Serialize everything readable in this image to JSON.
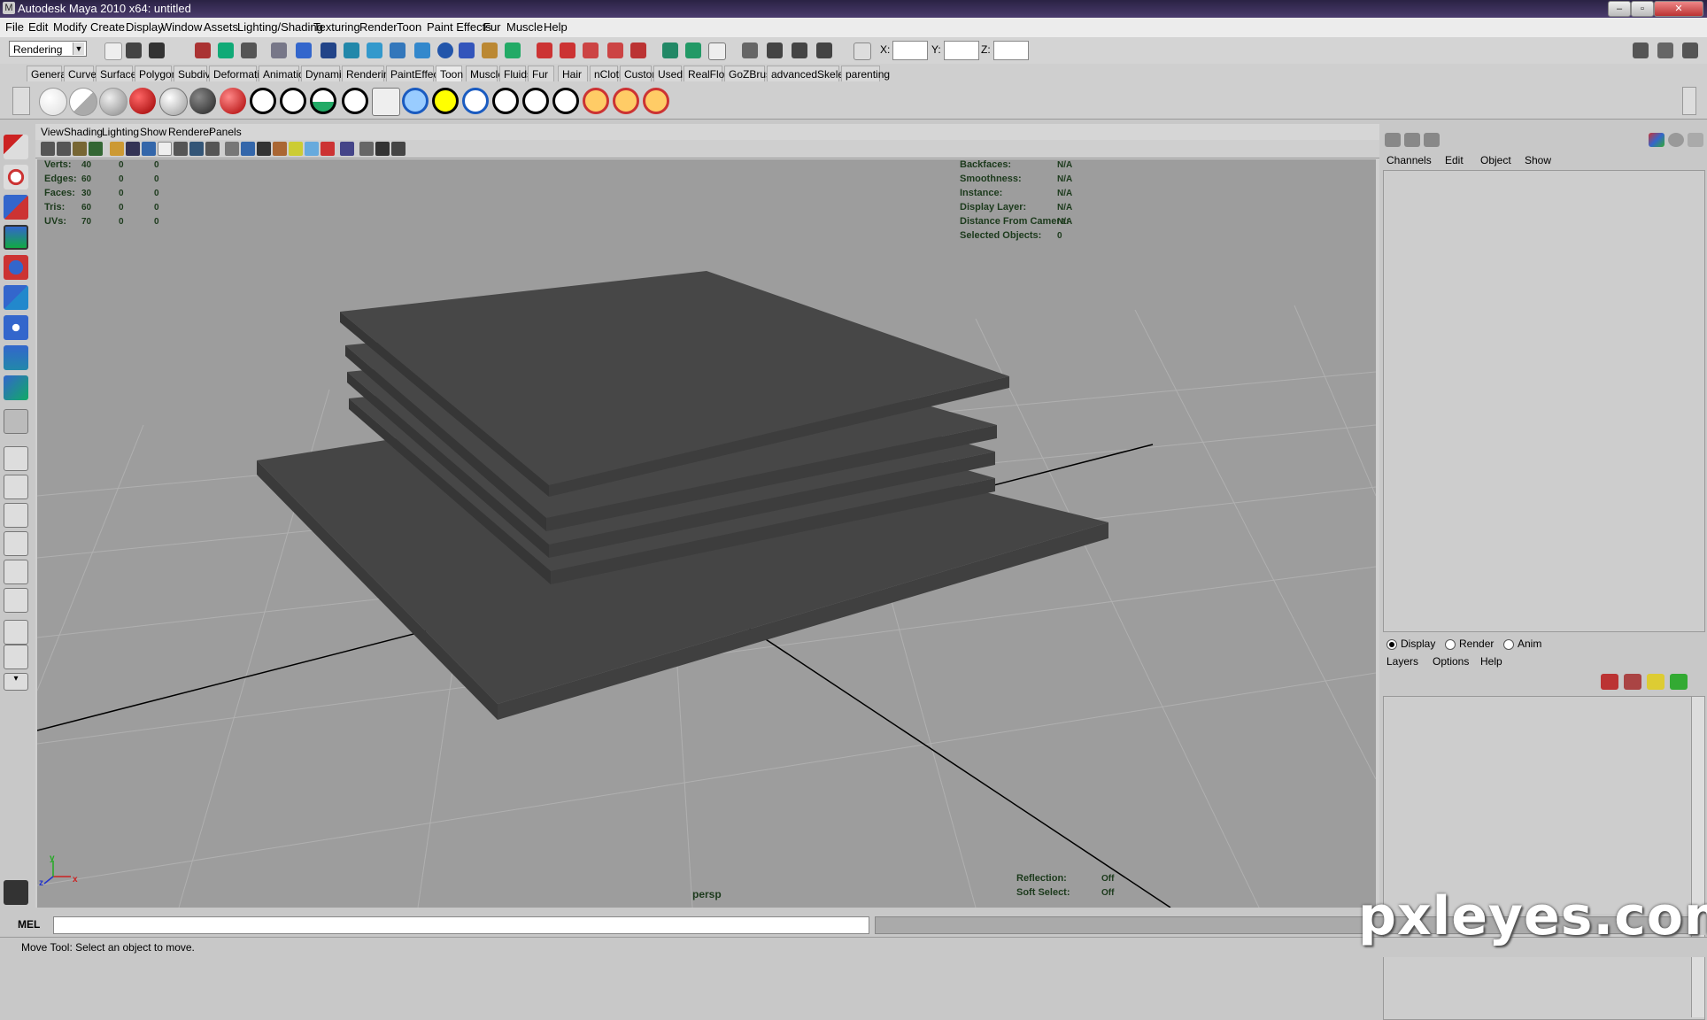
{
  "window": {
    "title": "Autodesk Maya 2010 x64: untitled",
    "minimize": "–",
    "maximize": "▫",
    "close": "✕"
  },
  "menubar": [
    "File",
    "Edit",
    "Modify",
    "Create",
    "Display",
    "Window",
    "Assets",
    "Lighting/Shading",
    "Texturing",
    "Render",
    "Toon",
    "Paint Effects",
    "Fur",
    "Muscle",
    "Help"
  ],
  "statusline": {
    "mode": "Rendering",
    "x_label": "X:",
    "y_label": "Y:",
    "z_label": "Z:"
  },
  "shelf_tabs": [
    "General",
    "Curves",
    "Surfaces",
    "Polygons",
    "Subdivs",
    "Deformation",
    "Animation",
    "Dynamics",
    "Rendering",
    "PaintEffects",
    "Toon",
    "Muscle",
    "Fluids",
    "Fur",
    "Hair",
    "nCloth",
    "Custom",
    "Used",
    "RealFlow",
    "GoZBrush",
    "advancedSkeleton",
    "parenting"
  ],
  "active_shelf_tab": "Toon",
  "viewport": {
    "menu": [
      "View",
      "Shading",
      "Lighting",
      "Show",
      "Renderer",
      "Panels"
    ],
    "camera_label": "persp",
    "hud_left": [
      {
        "label": "Verts:",
        "v1": "40",
        "v2": "0",
        "v3": "0"
      },
      {
        "label": "Edges:",
        "v1": "60",
        "v2": "0",
        "v3": "0"
      },
      {
        "label": "Faces:",
        "v1": "30",
        "v2": "0",
        "v3": "0"
      },
      {
        "label": "Tris:",
        "v1": "60",
        "v2": "0",
        "v3": "0"
      },
      {
        "label": "UVs:",
        "v1": "70",
        "v2": "0",
        "v3": "0"
      }
    ],
    "hud_right": [
      {
        "label": "Backfaces:",
        "value": "N/A"
      },
      {
        "label": "Smoothness:",
        "value": "N/A"
      },
      {
        "label": "Instance:",
        "value": "N/A"
      },
      {
        "label": "Display Layer:",
        "value": "N/A"
      },
      {
        "label": "Distance From Camera:",
        "value": "N/A"
      },
      {
        "label": "Selected Objects:",
        "value": "0"
      }
    ],
    "hud_bottom_right": [
      {
        "label": "Reflection:",
        "value": "Off"
      },
      {
        "label": "Soft Select:",
        "value": "Off"
      }
    ],
    "axis": {
      "x": "x",
      "y": "y",
      "z": "z"
    }
  },
  "channel_box": {
    "menu": [
      "Channels",
      "Edit",
      "Object",
      "Show"
    ]
  },
  "layer_editor": {
    "radios": [
      "Display",
      "Render",
      "Anim"
    ],
    "selected_radio": "Display",
    "menu": [
      "Layers",
      "Options",
      "Help"
    ]
  },
  "command_line": {
    "label": "MEL"
  },
  "help_line": {
    "text": "Move Tool: Select an object to move."
  },
  "watermark": "pxleyes.com"
}
